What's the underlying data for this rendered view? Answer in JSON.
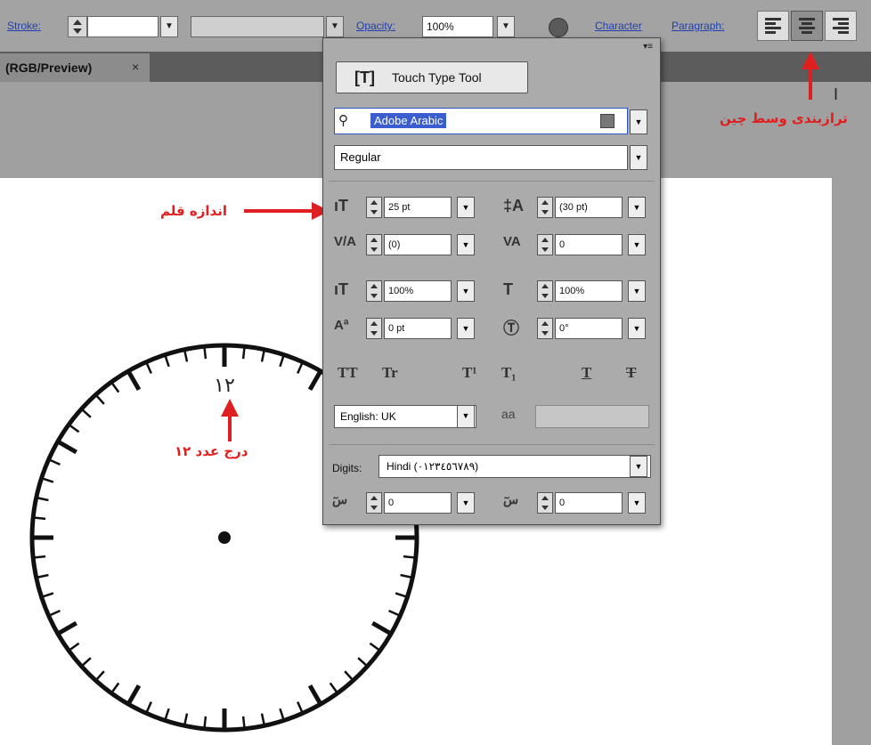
{
  "toolbar": {
    "stroke_label": "Stroke:",
    "opacity_label": "Opacity:",
    "opacity_value": "100%",
    "character_label": "Character",
    "paragraph_label": "Paragraph:"
  },
  "tab": {
    "title": "(RGB/Preview)",
    "close": "×"
  },
  "panel": {
    "touch_type_label": "Touch Type Tool",
    "font_family": "Adobe Arabic",
    "font_style": "Regular",
    "font_size": "25 pt",
    "leading": "(30 pt)",
    "kerning": "(0)",
    "tracking": "0",
    "vertical_scale": "100%",
    "horizontal_scale": "100%",
    "baseline_shift": "0 pt",
    "rotation": "0°",
    "case_buttons": [
      "TT",
      "Tr",
      "T¹",
      "T₁",
      "T",
      "T"
    ],
    "language": "English: UK",
    "digits_label": "Digits:",
    "digits_value": "Hindi (٠١٢٣٤٥٦٧٨٩)",
    "kashida_value": "0",
    "diacritic_value": "0"
  },
  "clock": {
    "numeral": "١٢"
  },
  "annotations": {
    "font_size": "اندازه قلم",
    "center_align": "ترازبندی وسط چین",
    "insert_number": "درج عدد ١٢"
  },
  "colors": {
    "annotation_red": "#e02020",
    "selection_blue": "#3a5dd0"
  }
}
